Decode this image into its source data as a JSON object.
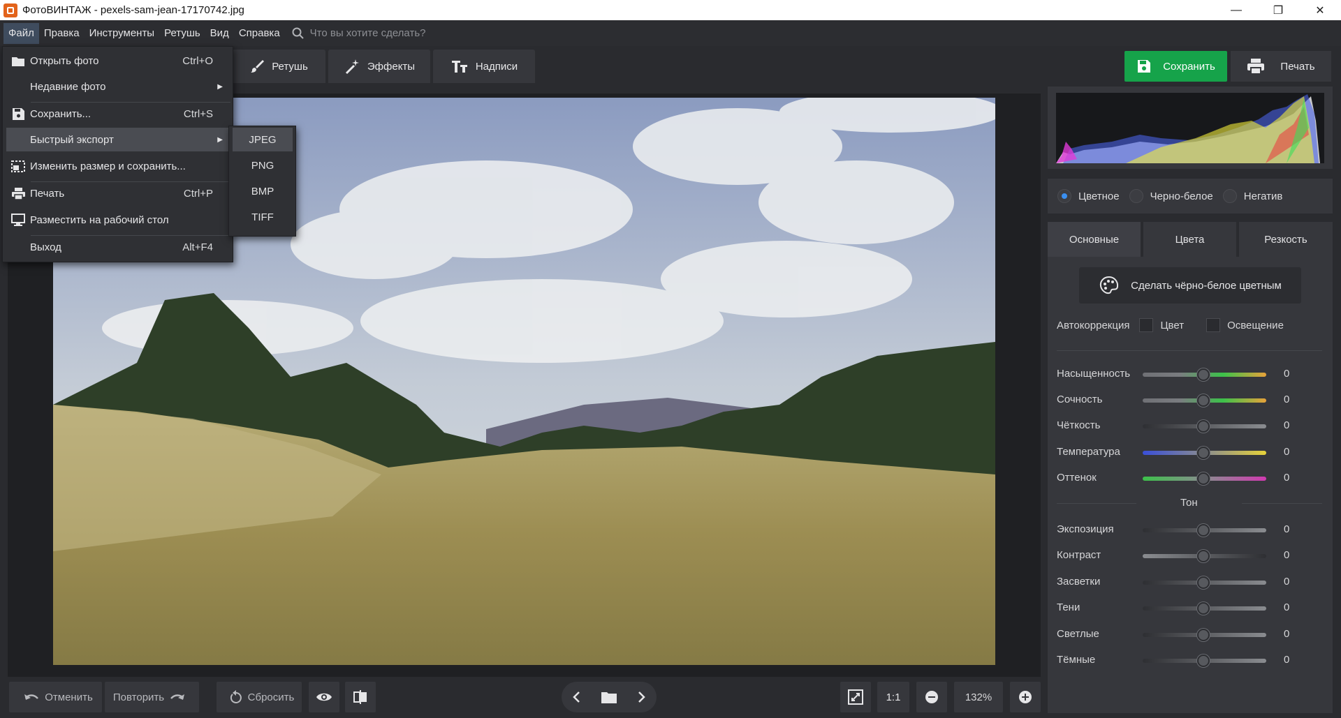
{
  "window": {
    "title": "ФотоВИНТАЖ - pexels-sam-jean-17170742.jpg",
    "minimize": "—",
    "maximize": "❐",
    "close": "✕"
  },
  "menubar": {
    "items": [
      "Файл",
      "Правка",
      "Инструменты",
      "Ретушь",
      "Вид",
      "Справка"
    ],
    "search_placeholder": "Что вы хотите сделать?"
  },
  "toolbar": {
    "tabs": [
      "Ретушь",
      "Эффекты",
      "Надписи"
    ],
    "save": "Сохранить",
    "print": "Печать"
  },
  "file_menu": {
    "items": [
      {
        "label": "Открыть фото",
        "shortcut": "Ctrl+O",
        "icon": "folder-icon"
      },
      {
        "label": "Недавние фото",
        "shortcut": "",
        "icon": ""
      },
      {
        "label": "Сохранить...",
        "shortcut": "Ctrl+S",
        "icon": "save-icon"
      },
      {
        "label": "Быстрый экспорт",
        "shortcut": "",
        "icon": ""
      },
      {
        "label": "Изменить размер и сохранить...",
        "shortcut": "",
        "icon": "resize-icon"
      },
      {
        "label": "Печать",
        "shortcut": "Ctrl+P",
        "icon": "printer-icon"
      },
      {
        "label": "Разместить на рабочий стол",
        "shortcut": "",
        "icon": "monitor-icon"
      },
      {
        "label": "Выход",
        "shortcut": "Alt+F4",
        "icon": ""
      }
    ]
  },
  "export_submenu": {
    "items": [
      "JPEG",
      "PNG",
      "BMP",
      "TIFF"
    ],
    "selected": "JPEG"
  },
  "right_panel": {
    "modes": [
      "Цветное",
      "Черно-белое",
      "Негатив"
    ],
    "selected_mode": "Цветное",
    "tabs": [
      "Основные",
      "Цвета",
      "Резкость"
    ],
    "active_tab": "Основные",
    "bw_button": "Сделать чёрно-белое цветным",
    "auto_label": "Автокоррекция",
    "auto_color": "Цвет",
    "auto_light": "Освещение",
    "color_sliders": [
      {
        "label": "Насыщенность",
        "value": "0"
      },
      {
        "label": "Сочность",
        "value": "0"
      },
      {
        "label": "Чёткость",
        "value": "0"
      },
      {
        "label": "Температура",
        "value": "0"
      },
      {
        "label": "Оттенок",
        "value": "0"
      }
    ],
    "tone_title": "Тон",
    "tone_sliders": [
      {
        "label": "Экспозиция",
        "value": "0"
      },
      {
        "label": "Контраст",
        "value": "0"
      },
      {
        "label": "Засветки",
        "value": "0"
      },
      {
        "label": "Тени",
        "value": "0"
      },
      {
        "label": "Светлые",
        "value": "0"
      },
      {
        "label": "Тёмные",
        "value": "0"
      }
    ]
  },
  "bottombar": {
    "undo": "Отменить",
    "redo": "Повторить",
    "reset": "Сбросить",
    "ratio": "1:1",
    "zoom": "132%"
  },
  "colors": {
    "accent": "#16a34a",
    "radio_on": "#3a8ff0",
    "menu_highlight": "#4a4c52"
  }
}
